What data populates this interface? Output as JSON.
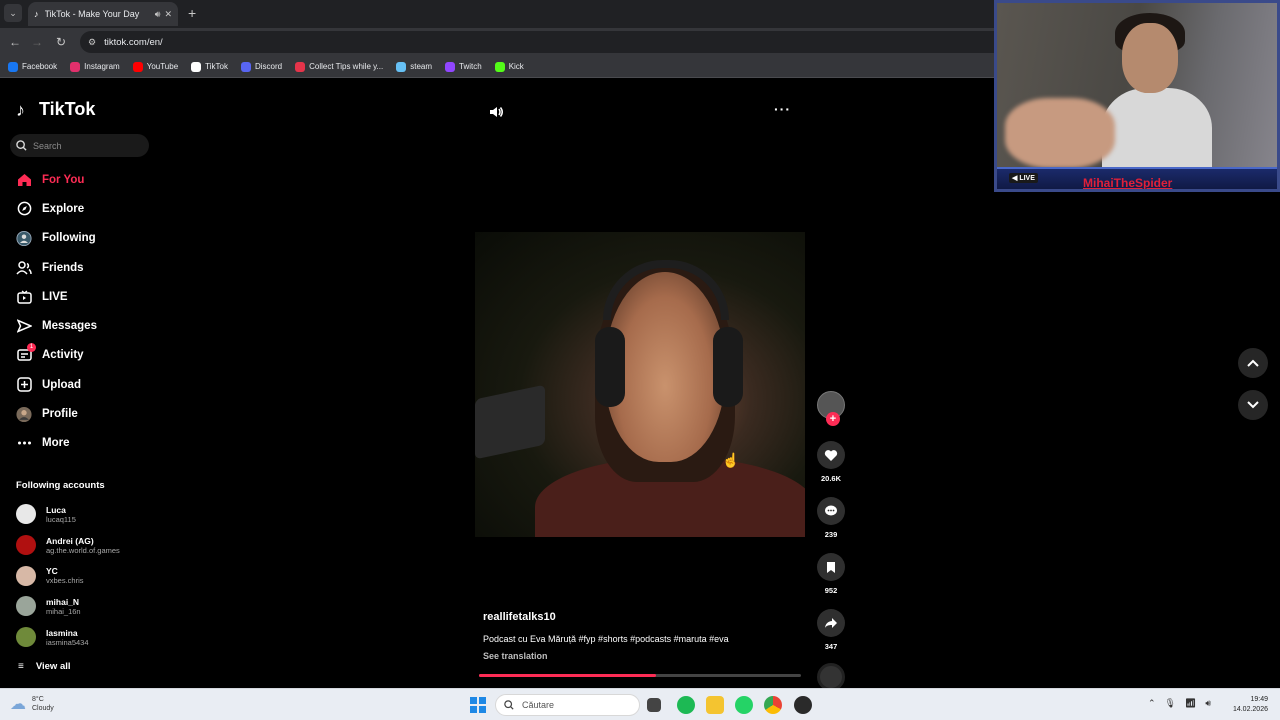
{
  "browser": {
    "tab_title": "TikTok - Make Your Day",
    "url": "tiktok.com/en/",
    "bookmarks": [
      {
        "label": "Facebook",
        "color": "#1877f2"
      },
      {
        "label": "Instagram",
        "color": "#e1306c"
      },
      {
        "label": "YouTube",
        "color": "#ff0000"
      },
      {
        "label": "TikTok",
        "color": "#ffffff"
      },
      {
        "label": "Discord",
        "color": "#5865f2"
      },
      {
        "label": "Collect Tips while y...",
        "color": "#e5344a"
      },
      {
        "label": "steam",
        "color": "#66c0f4"
      },
      {
        "label": "Twitch",
        "color": "#9146ff"
      },
      {
        "label": "Kick",
        "color": "#53fc18"
      }
    ]
  },
  "tiktok": {
    "logo": "TikTok",
    "search_placeholder": "Search",
    "nav": [
      {
        "label": "For You",
        "icon": "home-icon",
        "active": true
      },
      {
        "label": "Explore",
        "icon": "compass-icon"
      },
      {
        "label": "Following",
        "icon": "following-icon"
      },
      {
        "label": "Friends",
        "icon": "friends-icon"
      },
      {
        "label": "LIVE",
        "icon": "live-icon"
      },
      {
        "label": "Messages",
        "icon": "messages-icon"
      },
      {
        "label": "Activity",
        "icon": "activity-icon",
        "badge": "1"
      },
      {
        "label": "Upload",
        "icon": "upload-icon"
      },
      {
        "label": "Profile",
        "icon": "profile-avatar"
      },
      {
        "label": "More",
        "icon": "more-icon"
      }
    ],
    "following_title": "Following accounts",
    "following": [
      {
        "name": "Luca",
        "handle": "lucaq115",
        "color": "#e8e8e8"
      },
      {
        "name": "Andrei (AG)",
        "handle": "ag.the.world.of.games",
        "color": "#b01010"
      },
      {
        "name": "YC",
        "handle": "vxbes.chris",
        "color": "#d7b8a6"
      },
      {
        "name": "mihai_N",
        "handle": "mihai_16n",
        "color": "#9aa59a"
      },
      {
        "name": "Iasmina",
        "handle": "iasmina5434",
        "color": "#6f8a3a"
      }
    ],
    "view_all": "View all",
    "video": {
      "username": "reallifetalks10",
      "caption": "Podcast cu Eva Măruță #fyp #shorts #podcasts #maruta #eva",
      "see_translation": "See translation",
      "progress": 0.55,
      "likes": "20.6K",
      "comments": "239",
      "saves": "952",
      "shares": "347"
    }
  },
  "webcam": {
    "live_label": "LIVE",
    "streamer_name": "MihaiTheSpider"
  },
  "taskbar": {
    "weather_temp": "8°C",
    "weather_desc": "Cloudy",
    "search_placeholder": "Căutare",
    "time": "19:49",
    "date": "14.02.2026"
  }
}
